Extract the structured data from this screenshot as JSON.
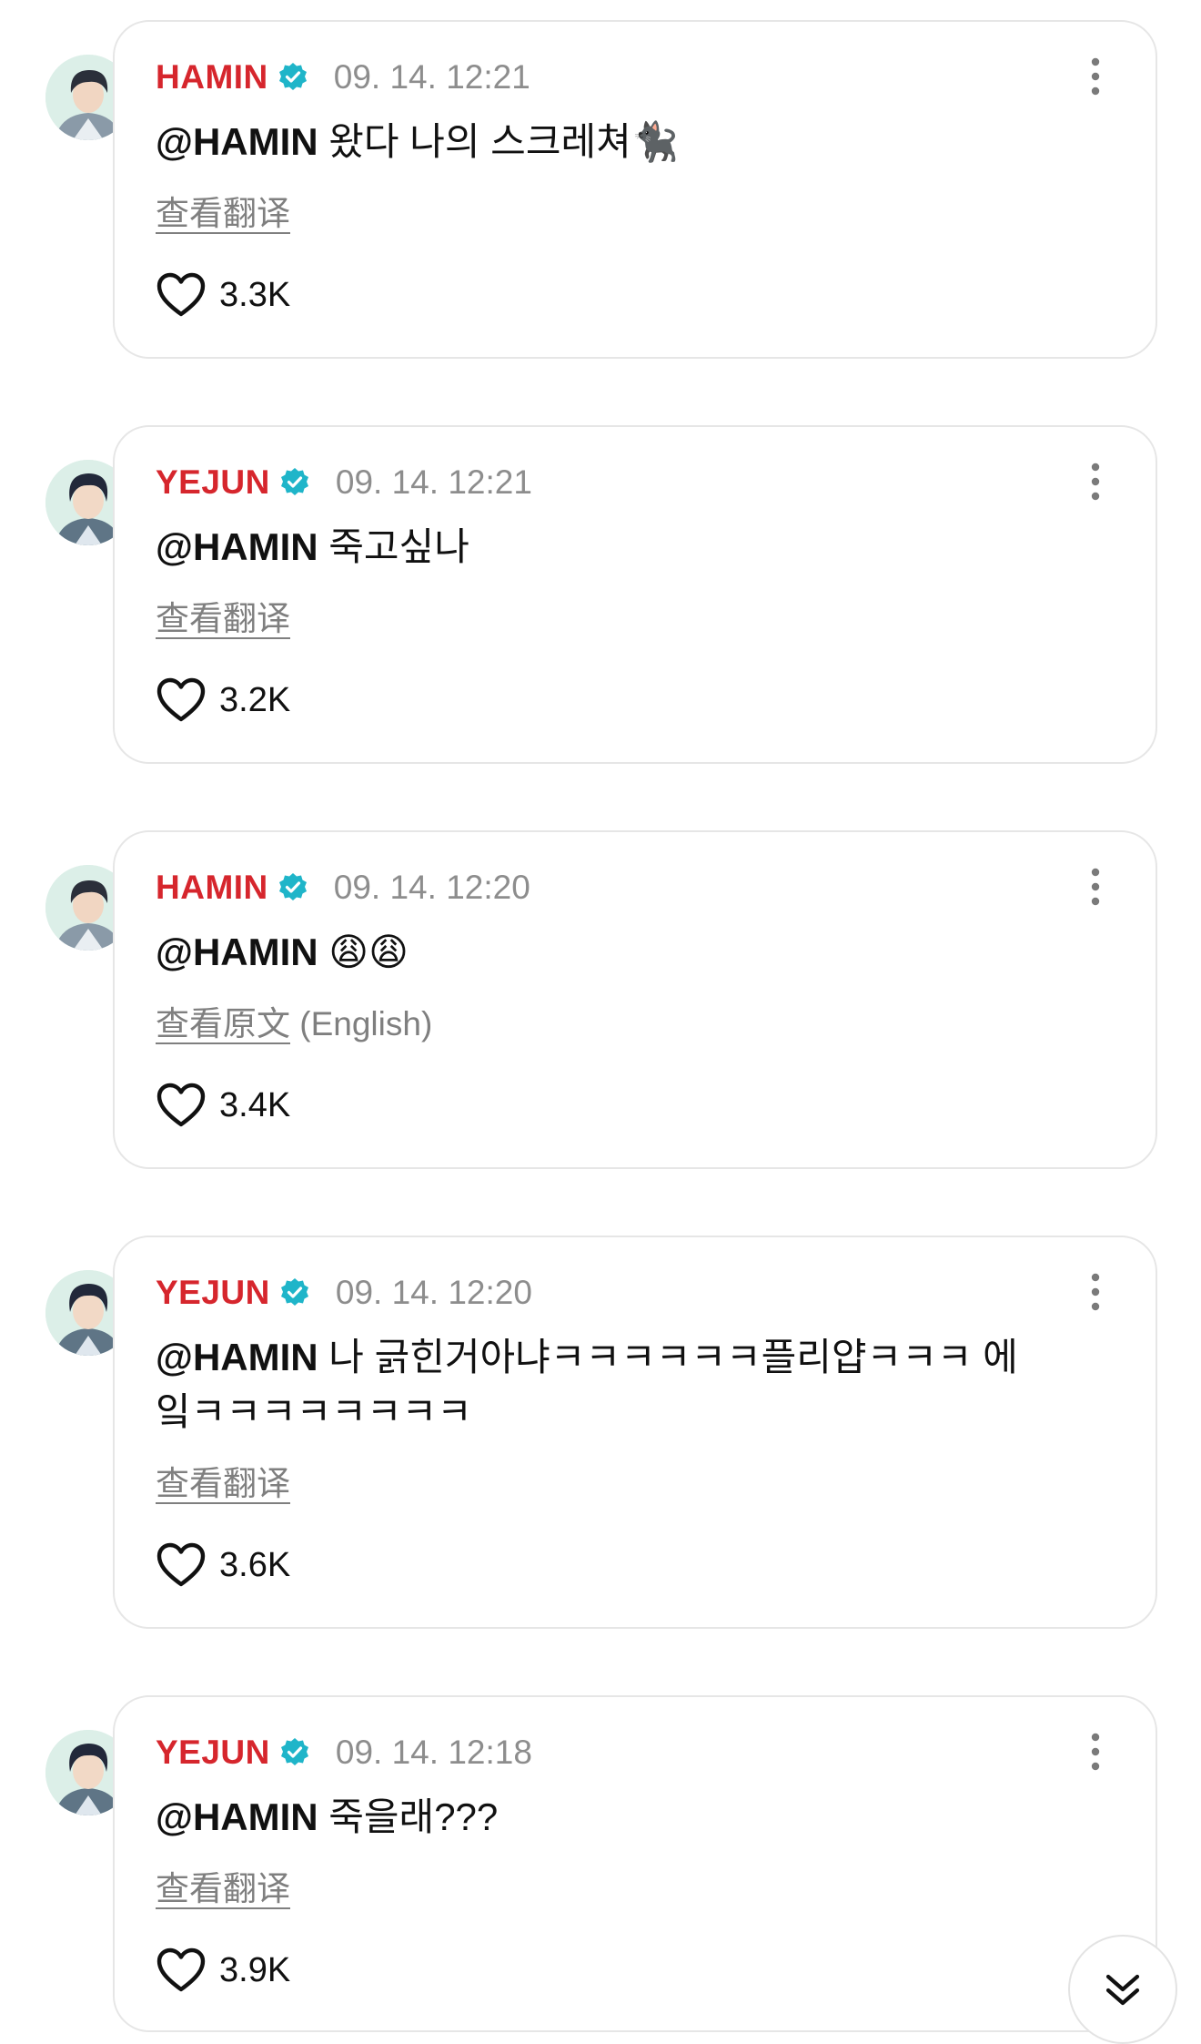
{
  "comments": [
    {
      "author": "HAMIN",
      "timestamp": "09. 14. 12:21",
      "mention": "@HAMIN",
      "text": " 왔다 나의 스크레쳐🐈‍⬛",
      "translate_link": "查看翻译",
      "translate_suffix": "",
      "likes": "3.3K"
    },
    {
      "author": "YEJUN",
      "timestamp": "09. 14. 12:21",
      "mention": "@HAMIN",
      "text": " 죽고싶나",
      "translate_link": "查看翻译",
      "translate_suffix": "",
      "likes": "3.2K"
    },
    {
      "author": "HAMIN",
      "timestamp": "09. 14. 12:20",
      "mention": "@HAMIN",
      "text": " 😩😩",
      "translate_link": "查看原文",
      "translate_suffix": " (English)",
      "likes": "3.4K"
    },
    {
      "author": "YEJUN",
      "timestamp": "09. 14. 12:20",
      "mention": "@HAMIN",
      "text": " 나 긁힌거아냐ㅋㅋㅋㅋㅋㅋ플리얍ㅋㅋㅋ 에잌ㅋㅋㅋㅋㅋㅋㅋㅋ",
      "translate_link": "查看翻译",
      "translate_suffix": "",
      "likes": "3.6K"
    },
    {
      "author": "YEJUN",
      "timestamp": "09. 14. 12:18",
      "mention": "@HAMIN",
      "text": " 죽을래???",
      "translate_link": "查看翻译",
      "translate_suffix": "",
      "likes": "3.9K"
    }
  ],
  "icons": {
    "verified": "verified-badge-icon",
    "menu": "more-vertical-icon",
    "like": "heart-outline-icon",
    "scroll": "double-chevron-down-icon"
  },
  "colors": {
    "author": "#d6262d",
    "verified": "#1fb5c9",
    "timestamp": "#8d8d8d",
    "card_border": "#e6e6e6"
  }
}
